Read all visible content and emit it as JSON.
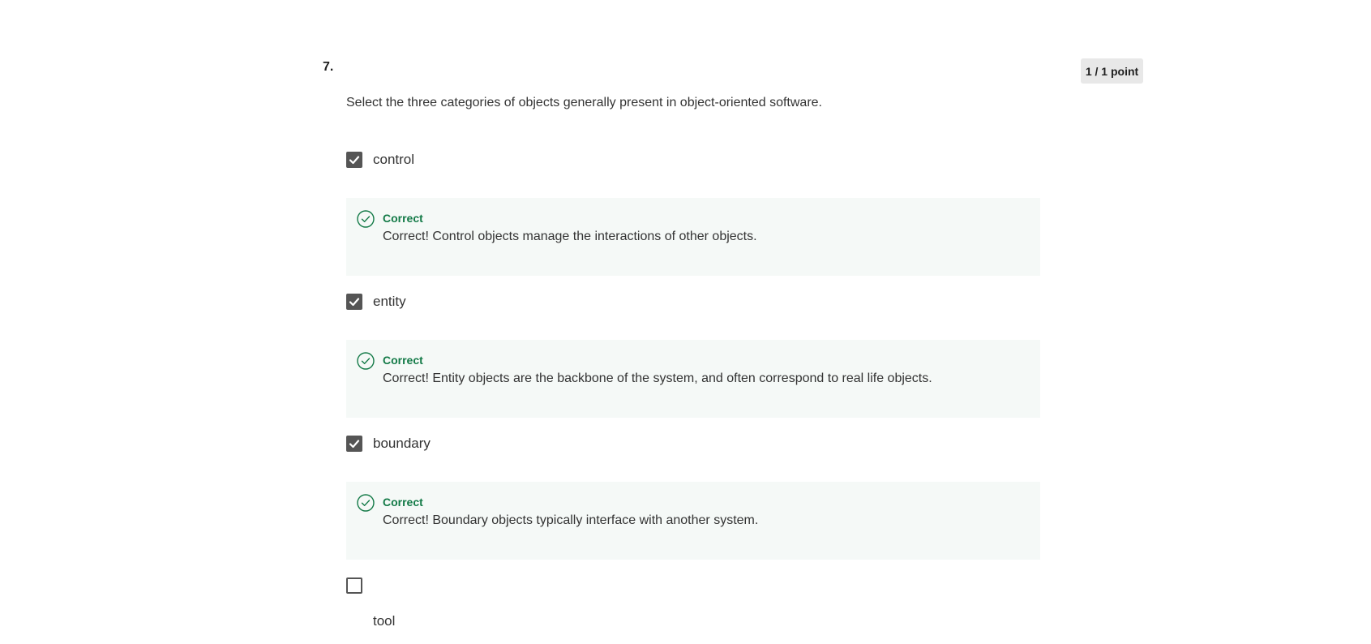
{
  "question": {
    "number": "7.",
    "score": "1 / 1 point",
    "prompt": "Select the three categories of objects generally present in object-oriented software."
  },
  "options": [
    {
      "label": "control",
      "checked": true,
      "feedback": {
        "title": "Correct",
        "text": "Correct! Control objects manage the interactions of other objects."
      }
    },
    {
      "label": "entity",
      "checked": true,
      "feedback": {
        "title": "Correct",
        "text": "Correct! Entity objects are the backbone of the system, and often correspond to real life objects."
      }
    },
    {
      "label": "boundary",
      "checked": true,
      "feedback": {
        "title": "Correct",
        "text": "Correct! Boundary objects typically interface with another system."
      }
    },
    {
      "label": "tool",
      "checked": false
    }
  ],
  "colors": {
    "correct_green": "#137a47",
    "feedback_bg": "#f5f9f7",
    "checkbox_fill": "#555555",
    "badge_bg": "#e8e8e8"
  },
  "icons": {
    "checked": "checkmark-icon",
    "feedback": "check-circle-icon"
  }
}
